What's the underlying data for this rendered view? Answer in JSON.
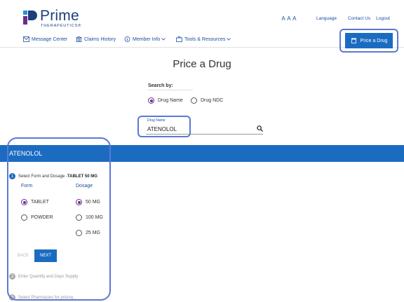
{
  "brand": {
    "name": "Prime",
    "sub": "THERAPEUTICS®",
    "color": "#1b3f7a"
  },
  "top_links": {
    "text_size": "A A A",
    "language": "Language",
    "contact": "Contact Us",
    "logout": "Logout"
  },
  "nav": {
    "message_center": "Message Center",
    "claims_history": "Claims History",
    "member_info": "Member Info",
    "tools_resources": "Tools & Resources",
    "price_drug": "Price a Drug"
  },
  "page": {
    "title": "Price a Drug",
    "search_by": "Search by:",
    "search_options": [
      {
        "label": "Drug Name",
        "selected": true
      },
      {
        "label": "Drug NDC",
        "selected": false
      }
    ],
    "drug_field": {
      "label": "Drug Name",
      "value": "ATENOLOL"
    }
  },
  "drug_bar": {
    "title": "ATENOLOL"
  },
  "wizard": {
    "step1": {
      "num": "1",
      "label": "Select Form and Dosage - ",
      "value": "TABLET 50 MG"
    },
    "form_header": "Form",
    "dosage_header": "Dosage",
    "forms": [
      {
        "label": "TABLET",
        "selected": true
      },
      {
        "label": "POWDER",
        "selected": false
      }
    ],
    "dosages": [
      {
        "label": "50 MG",
        "selected": true
      },
      {
        "label": "100 MG",
        "selected": false
      },
      {
        "label": "25 MG",
        "selected": false
      }
    ],
    "back": "BACK",
    "next": "NEXT",
    "step2": {
      "num": "2",
      "label": "Enter Quantity and Days Supply"
    },
    "step3": {
      "num": "3",
      "label": "Select Pharmacies for pricing"
    }
  },
  "colors": {
    "accent": "#1b6cc1",
    "radio_selected": "#6b2d8c",
    "highlight": "#5b78d6"
  }
}
